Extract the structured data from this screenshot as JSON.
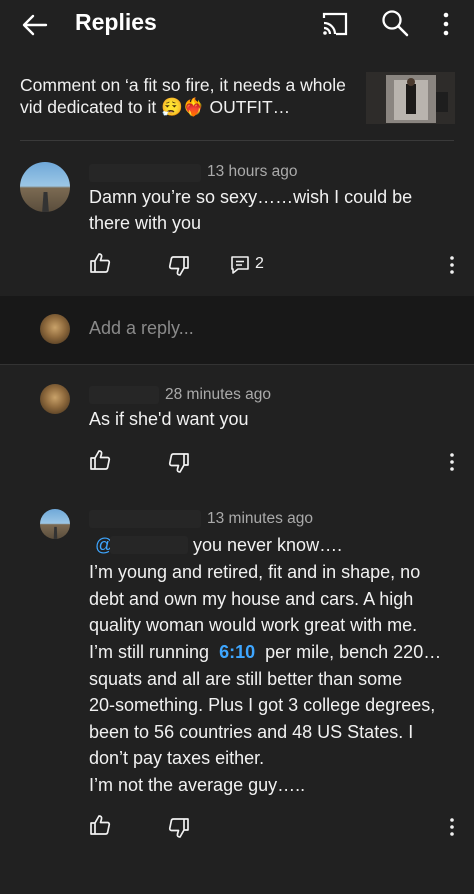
{
  "header": {
    "title": "Replies"
  },
  "context": {
    "text": "Comment on ‘a fit so fire, it needs a whole vid dedicated to it 😮‍💨❤️‍🔥 OUTFIT…"
  },
  "parent_comment": {
    "time": "13 hours ago",
    "text": "Damn you’re so sexy……wish I could be there with you",
    "reply_count": "2"
  },
  "reply_box": {
    "placeholder": "Add a reply..."
  },
  "replies": [
    {
      "time": "28 minutes ago",
      "text": "As if she'd want you"
    },
    {
      "time": "13 minutes ago",
      "mention": "@",
      "line1": "you never know….",
      "line2": "I’m young and retired, fit and in shape, no",
      "line3": "debt and own my house and cars. A high",
      "line4": "quality woman would work great with me.",
      "line5_a": "I’m still running",
      "timestamp_link": "6:10",
      "line5_b": "per mile, bench 220…",
      "line6": "squats and all are still better than some",
      "line7": "20-something. Plus I got 3 college degrees,",
      "line8": "been to 56 countries and 48 US States. I",
      "line9": "don’t pay taxes either.",
      "line10": "I’m not the average guy….."
    }
  ],
  "colors": {
    "background": "#212121",
    "link": "#3ea6ff",
    "muted": "#aaaaaa"
  }
}
